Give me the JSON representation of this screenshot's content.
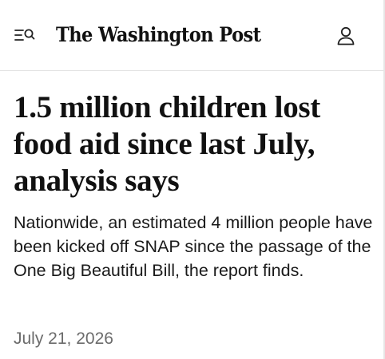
{
  "header": {
    "masthead": "The Washington Post",
    "menu_icon": "search-menu-icon",
    "account_icon": "person-icon"
  },
  "article": {
    "headline": "1.5 million children lost food aid since last July, analysis says",
    "dek": "Nationwide, an estimated 4 million people have been kicked off SNAP since the passage of the One Big Beautiful Bill, the report finds.",
    "date": "July 21, 2026"
  },
  "colors": {
    "text": "#111111",
    "date_gray": "#6b6b6b",
    "divider": "#e3e3e3",
    "background": "#ffffff"
  }
}
